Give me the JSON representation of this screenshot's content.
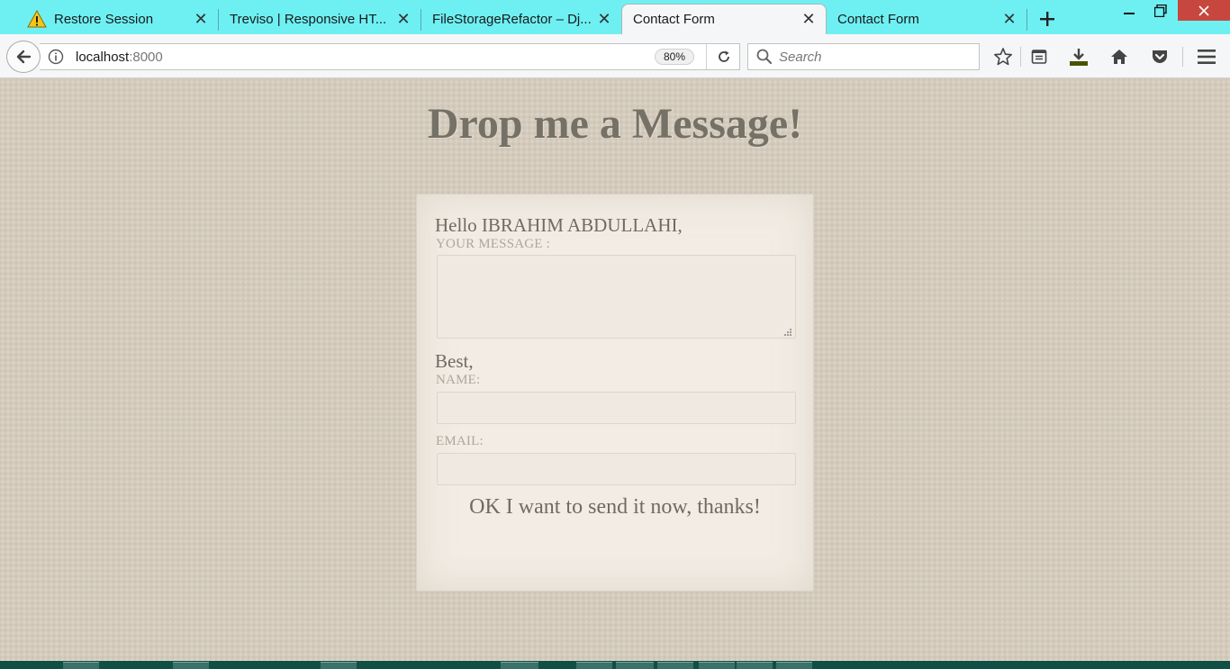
{
  "browser": {
    "tabs": [
      {
        "title": "Restore Session",
        "icon": "warning-icon",
        "active": false
      },
      {
        "title": "Treviso | Responsive HT...",
        "active": false
      },
      {
        "title": "FileStorageRefactor – Dj...",
        "active": false
      },
      {
        "title": "Contact Form",
        "active": true
      },
      {
        "title": "Contact Form",
        "active": false
      }
    ],
    "url_host": "localhost",
    "url_port": ":8000",
    "zoom": "80%",
    "search_placeholder": "Search",
    "colors": {
      "tabstrip": "#6ef0f3",
      "toolbar": "#f5f6f7"
    }
  },
  "page": {
    "title": "Drop me a Message!",
    "greeting": "Hello IBRAHIM ABDULLAHI,",
    "message_label": "YOUR MESSAGE :",
    "message_value": "",
    "closing": "Best,",
    "name_label": "NAME:",
    "name_value": "",
    "email_label": "EMAIL:",
    "email_value": "",
    "submit_label": "OK I want to send it now, thanks!",
    "colors": {
      "background": "#d4cbbd",
      "card": "#f2ece4",
      "text": "#6f6a62",
      "label": "#aea699"
    }
  }
}
